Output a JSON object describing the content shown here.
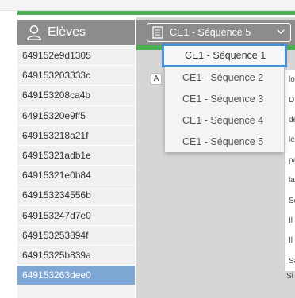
{
  "students_panel": {
    "title": "Elèves",
    "items": [
      "649152e9d1305",
      "649153203333c",
      "649153208ca4b",
      "64915320e9ff5",
      "649153218a21f",
      "64915321adb1e",
      "64915321e0b84",
      "649153234556b",
      "649153247d7e0",
      "649153253894f",
      "64915325b839a",
      "649153263dee0"
    ],
    "selected_index": 11
  },
  "sequence_selector": {
    "selected_label": "CE1 - Séquence 5",
    "options": [
      "CE1 - Séquence 1",
      "CE1 - Séquence 2",
      "CE1 - Séquence 3",
      "CE1 - Séquence 4",
      "CE1 - Séquence 5"
    ],
    "highlighted_index": 0
  },
  "content": {
    "small_button": "A",
    "line_fragments": [
      "lo",
      "D",
      "de",
      "le",
      "pa",
      "la",
      "Sc",
      "Il",
      "Il",
      "Sa"
    ],
    "below_fragment": "Si"
  },
  "colors": {
    "green_accent": "#4caf50",
    "header_gray": "#8c8c8c",
    "selected_blue": "#7fa7d6",
    "focus_blue": "#4a90d9"
  }
}
